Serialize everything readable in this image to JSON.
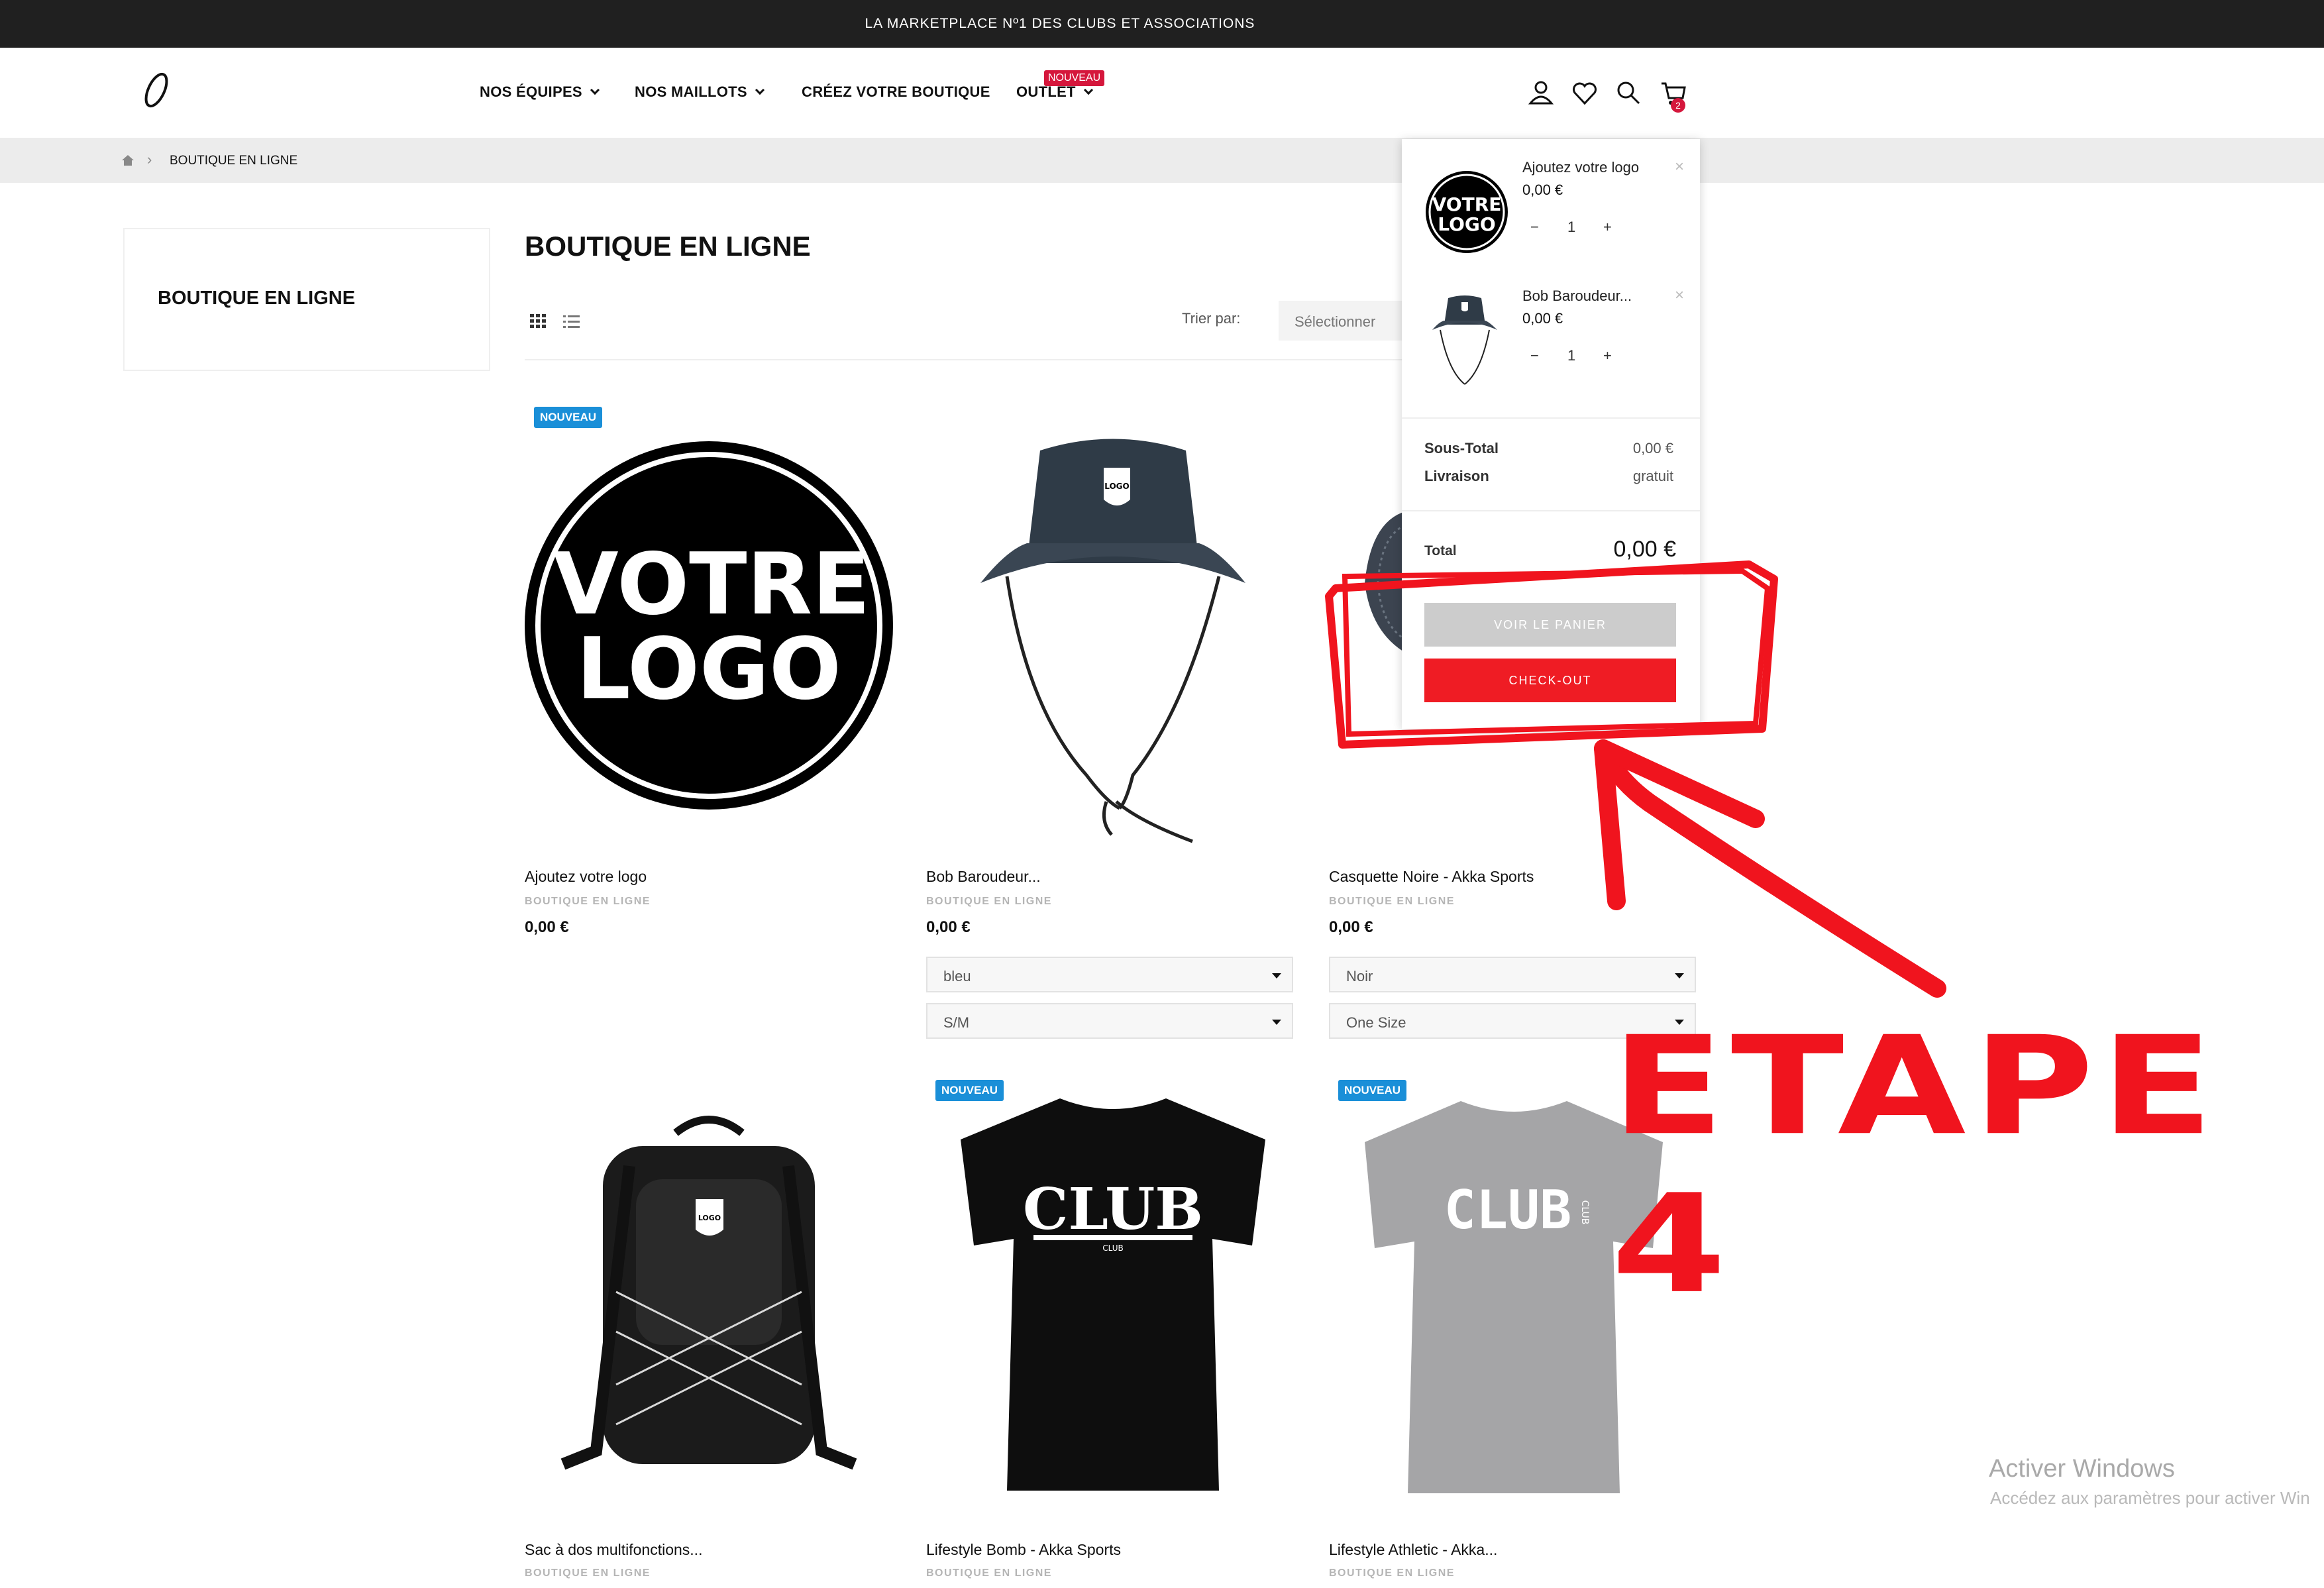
{
  "topbar": {
    "text": "LA MARKETPLACE Nº1 DES CLUBS ET ASSOCIATIONS"
  },
  "nav": {
    "items": [
      "NOS ÉQUIPES",
      "NOS MAILLOTS",
      "CRÉEZ VOTRE BOUTIQUE",
      "OUTLET"
    ],
    "new_badge": "NOUVEAU"
  },
  "header_icons": [
    "user-icon",
    "heart-icon",
    "search-icon",
    "cart-icon"
  ],
  "cart_count": "2",
  "breadcrumb": {
    "home_icon": "home-icon",
    "current": "BOUTIQUE EN LIGNE"
  },
  "sidebar": {
    "title": "BOUTIQUE EN LIGNE"
  },
  "main": {
    "title": "BOUTIQUE EN LIGNE",
    "sort_label": "Trier par:",
    "sort_value": "Sélectionner"
  },
  "products": [
    {
      "name": "Ajoutez votre logo",
      "category": "BOUTIQUE EN LIGNE",
      "price": "0,00 €",
      "badge": "NOUVEAU",
      "image_text": [
        "VOTRE",
        "LOGO"
      ]
    },
    {
      "name": "Bob Baroudeur...",
      "category": "BOUTIQUE EN LIGNE",
      "price": "0,00 €",
      "options": [
        "bleu",
        "S/M"
      ],
      "image_text": "LOGO"
    },
    {
      "name": "Casquette Noire - Akka Sports",
      "category": "BOUTIQUE EN LIGNE",
      "price": "0,00 €",
      "options": [
        "Noir",
        "One Size"
      ]
    },
    {
      "name": "Sac à dos multifonctions...",
      "category": "BOUTIQUE EN LIGNE",
      "image_text": "LOGO"
    },
    {
      "name": "Lifestyle Bomb - Akka Sports",
      "category": "BOUTIQUE EN LIGNE",
      "badge": "NOUVEAU",
      "image_text": "CLUB",
      "image_subtext": "CLUB"
    },
    {
      "name": "Lifestyle Athletic - Akka...",
      "category": "BOUTIQUE EN LIGNE",
      "badge": "NOUVEAU",
      "image_text": "CLUB",
      "image_subtext": "CLUB"
    }
  ],
  "cart": {
    "items": [
      {
        "name": "Ajoutez votre logo",
        "price": "0,00 €",
        "qty": "1",
        "thumb_text": [
          "VOTRE",
          "LOGO"
        ]
      },
      {
        "name": "Bob Baroudeur...",
        "price": "0,00 €",
        "qty": "1"
      }
    ],
    "qty_minus": "−",
    "qty_plus": "+",
    "remove": "×",
    "subtotal_label": "Sous-Total",
    "subtotal_value": "0,00 €",
    "shipping_label": "Livraison",
    "shipping_value": "gratuit",
    "total_label": "Total",
    "total_value": "0,00 €",
    "view_cart": "VOIR LE PANIER",
    "checkout": "CHECK-OUT"
  },
  "annotation": {
    "text": "ETAPE 4",
    "color": "#f0141e"
  },
  "windows_watermark": {
    "line1": "Activer Windows",
    "line2": "Accédez aux paramètres pour activer Win"
  },
  "colors": {
    "topbar": "#202020",
    "badge_new": "#1a8fd8",
    "nav_badge": "#d5173c",
    "checkout": "#ef1c24",
    "view_cart": "#cccccc"
  }
}
